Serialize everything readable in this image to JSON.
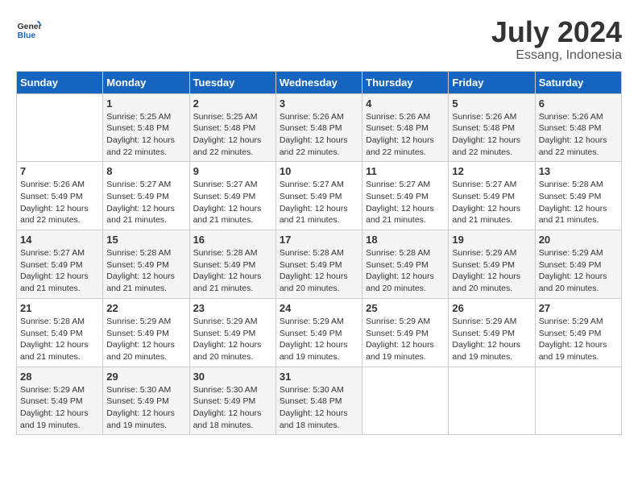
{
  "header": {
    "logo_general": "General",
    "logo_blue": "Blue",
    "month_title": "July 2024",
    "subtitle": "Essang, Indonesia"
  },
  "days_of_week": [
    "Sunday",
    "Monday",
    "Tuesday",
    "Wednesday",
    "Thursday",
    "Friday",
    "Saturday"
  ],
  "weeks": [
    [
      {
        "day": "",
        "info": ""
      },
      {
        "day": "1",
        "info": "Sunrise: 5:25 AM\nSunset: 5:48 PM\nDaylight: 12 hours\nand 22 minutes."
      },
      {
        "day": "2",
        "info": "Sunrise: 5:25 AM\nSunset: 5:48 PM\nDaylight: 12 hours\nand 22 minutes."
      },
      {
        "day": "3",
        "info": "Sunrise: 5:26 AM\nSunset: 5:48 PM\nDaylight: 12 hours\nand 22 minutes."
      },
      {
        "day": "4",
        "info": "Sunrise: 5:26 AM\nSunset: 5:48 PM\nDaylight: 12 hours\nand 22 minutes."
      },
      {
        "day": "5",
        "info": "Sunrise: 5:26 AM\nSunset: 5:48 PM\nDaylight: 12 hours\nand 22 minutes."
      },
      {
        "day": "6",
        "info": "Sunrise: 5:26 AM\nSunset: 5:48 PM\nDaylight: 12 hours\nand 22 minutes."
      }
    ],
    [
      {
        "day": "7",
        "info": ""
      },
      {
        "day": "8",
        "info": "Sunrise: 5:27 AM\nSunset: 5:49 PM\nDaylight: 12 hours\nand 21 minutes."
      },
      {
        "day": "9",
        "info": "Sunrise: 5:27 AM\nSunset: 5:49 PM\nDaylight: 12 hours\nand 21 minutes."
      },
      {
        "day": "10",
        "info": "Sunrise: 5:27 AM\nSunset: 5:49 PM\nDaylight: 12 hours\nand 21 minutes."
      },
      {
        "day": "11",
        "info": "Sunrise: 5:27 AM\nSunset: 5:49 PM\nDaylight: 12 hours\nand 21 minutes."
      },
      {
        "day": "12",
        "info": "Sunrise: 5:27 AM\nSunset: 5:49 PM\nDaylight: 12 hours\nand 21 minutes."
      },
      {
        "day": "13",
        "info": "Sunrise: 5:28 AM\nSunset: 5:49 PM\nDaylight: 12 hours\nand 21 minutes."
      }
    ],
    [
      {
        "day": "14",
        "info": ""
      },
      {
        "day": "15",
        "info": "Sunrise: 5:28 AM\nSunset: 5:49 PM\nDaylight: 12 hours\nand 21 minutes."
      },
      {
        "day": "16",
        "info": "Sunrise: 5:28 AM\nSunset: 5:49 PM\nDaylight: 12 hours\nand 21 minutes."
      },
      {
        "day": "17",
        "info": "Sunrise: 5:28 AM\nSunset: 5:49 PM\nDaylight: 12 hours\nand 20 minutes."
      },
      {
        "day": "18",
        "info": "Sunrise: 5:28 AM\nSunset: 5:49 PM\nDaylight: 12 hours\nand 20 minutes."
      },
      {
        "day": "19",
        "info": "Sunrise: 5:29 AM\nSunset: 5:49 PM\nDaylight: 12 hours\nand 20 minutes."
      },
      {
        "day": "20",
        "info": "Sunrise: 5:29 AM\nSunset: 5:49 PM\nDaylight: 12 hours\nand 20 minutes."
      }
    ],
    [
      {
        "day": "21",
        "info": ""
      },
      {
        "day": "22",
        "info": "Sunrise: 5:29 AM\nSunset: 5:49 PM\nDaylight: 12 hours\nand 20 minutes."
      },
      {
        "day": "23",
        "info": "Sunrise: 5:29 AM\nSunset: 5:49 PM\nDaylight: 12 hours\nand 20 minutes."
      },
      {
        "day": "24",
        "info": "Sunrise: 5:29 AM\nSunset: 5:49 PM\nDaylight: 12 hours\nand 19 minutes."
      },
      {
        "day": "25",
        "info": "Sunrise: 5:29 AM\nSunset: 5:49 PM\nDaylight: 12 hours\nand 19 minutes."
      },
      {
        "day": "26",
        "info": "Sunrise: 5:29 AM\nSunset: 5:49 PM\nDaylight: 12 hours\nand 19 minutes."
      },
      {
        "day": "27",
        "info": "Sunrise: 5:29 AM\nSunset: 5:49 PM\nDaylight: 12 hours\nand 19 minutes."
      }
    ],
    [
      {
        "day": "28",
        "info": "Sunrise: 5:29 AM\nSunset: 5:49 PM\nDaylight: 12 hours\nand 19 minutes."
      },
      {
        "day": "29",
        "info": "Sunrise: 5:30 AM\nSunset: 5:49 PM\nDaylight: 12 hours\nand 19 minutes."
      },
      {
        "day": "30",
        "info": "Sunrise: 5:30 AM\nSunset: 5:49 PM\nDaylight: 12 hours\nand 18 minutes."
      },
      {
        "day": "31",
        "info": "Sunrise: 5:30 AM\nSunset: 5:48 PM\nDaylight: 12 hours\nand 18 minutes."
      },
      {
        "day": "",
        "info": ""
      },
      {
        "day": "",
        "info": ""
      },
      {
        "day": "",
        "info": ""
      }
    ]
  ],
  "week7_sunday": "Sunrise: 5:26 AM\nSunset: 5:49 PM\nDaylight: 12 hours\nand 22 minutes.",
  "week14_sunday": "Sunrise: 5:27 AM\nSunset: 5:49 PM\nDaylight: 12 hours\nand 21 minutes.",
  "week21_sunday": "Sunrise: 5:28 AM\nSunset: 5:49 PM\nDaylight: 12 hours\nand 21 minutes.",
  "week28_sunday_extra": ""
}
